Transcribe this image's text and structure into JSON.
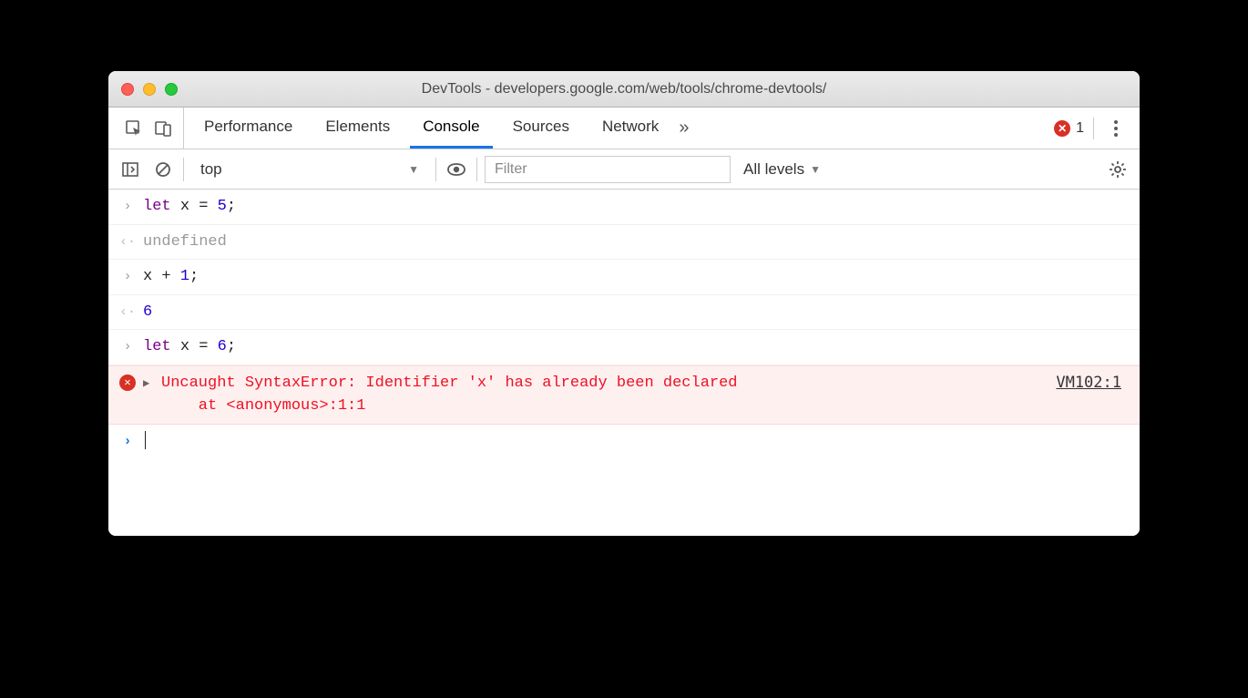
{
  "window": {
    "title": "DevTools - developers.google.com/web/tools/chrome-devtools/"
  },
  "tabs": {
    "items": [
      "Performance",
      "Elements",
      "Console",
      "Sources",
      "Network"
    ],
    "active": "Console",
    "overflow": "»"
  },
  "errorIndicator": {
    "count": "1"
  },
  "toolbar": {
    "context": "top",
    "filterPlaceholder": "Filter",
    "levels": "All levels"
  },
  "console": {
    "lines": [
      {
        "type": "input",
        "tokens": [
          [
            "kw",
            "let"
          ],
          [
            "sp",
            " "
          ],
          [
            "id",
            "x"
          ],
          [
            "sp",
            " "
          ],
          [
            "op",
            "="
          ],
          [
            "sp",
            " "
          ],
          [
            "num",
            "5"
          ],
          [
            "op",
            ";"
          ]
        ]
      },
      {
        "type": "result",
        "text": "undefined",
        "cls": "undef"
      },
      {
        "type": "input",
        "tokens": [
          [
            "id",
            "x"
          ],
          [
            "sp",
            " "
          ],
          [
            "op",
            "+"
          ],
          [
            "sp",
            " "
          ],
          [
            "num",
            "1"
          ],
          [
            "op",
            ";"
          ]
        ]
      },
      {
        "type": "result",
        "text": "6",
        "cls": "retval"
      },
      {
        "type": "input",
        "tokens": [
          [
            "kw",
            "let"
          ],
          [
            "sp",
            " "
          ],
          [
            "id",
            "x"
          ],
          [
            "sp",
            " "
          ],
          [
            "op",
            "="
          ],
          [
            "sp",
            " "
          ],
          [
            "num",
            "6"
          ],
          [
            "op",
            ";"
          ]
        ]
      },
      {
        "type": "error",
        "message": "Uncaught SyntaxError: Identifier 'x' has already been declared\n    at <anonymous>:1:1",
        "source": "VM102:1"
      },
      {
        "type": "prompt"
      }
    ]
  }
}
